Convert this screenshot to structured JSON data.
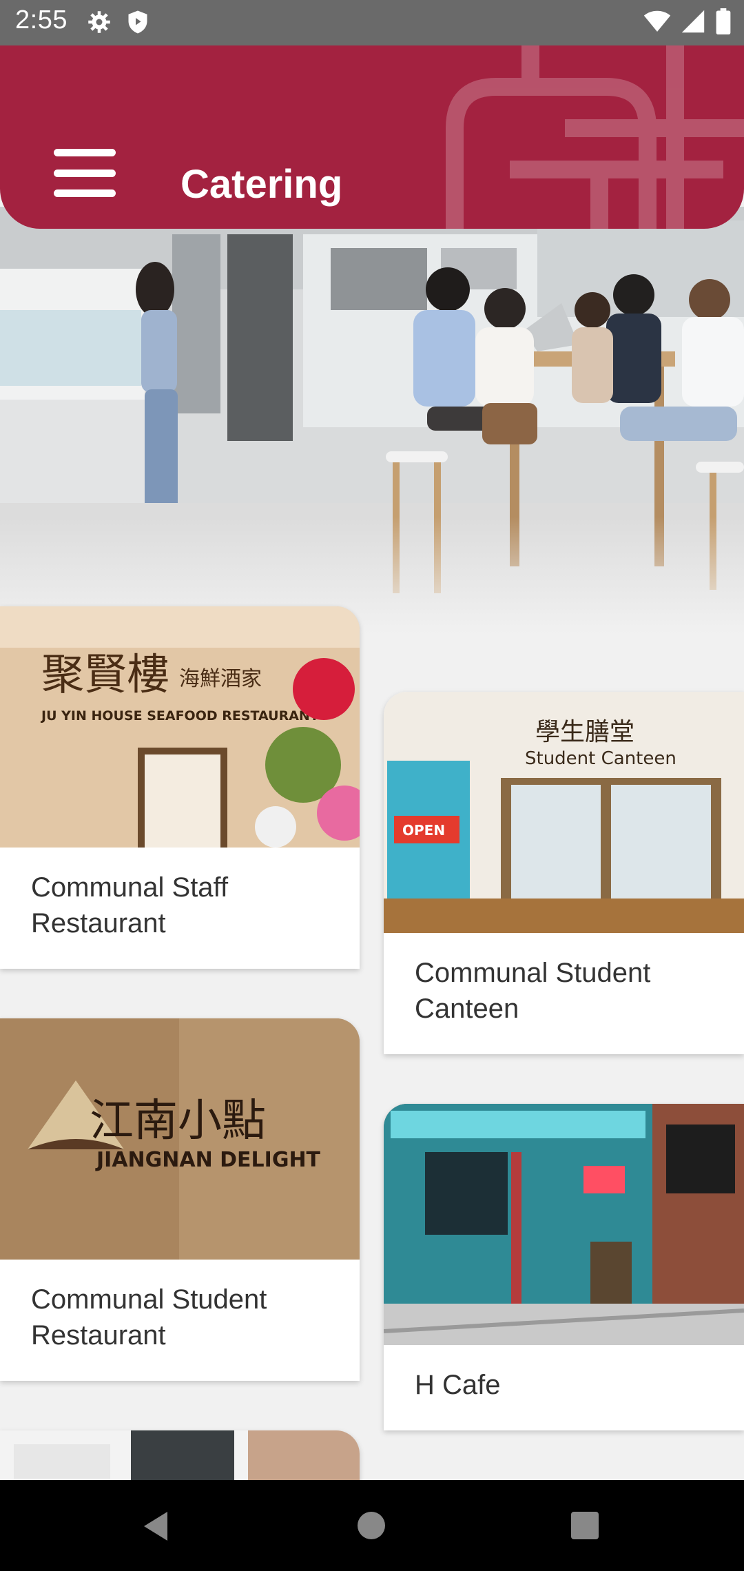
{
  "status_bar": {
    "time": "2:55",
    "icons": [
      "settings-icon",
      "shield-icon",
      "wifi-icon",
      "signal-icon",
      "battery-icon"
    ]
  },
  "app_bar": {
    "title": "Catering",
    "menu_icon": "hamburger-menu-icon",
    "color": "#a32240"
  },
  "restaurants": [
    {
      "name": "Communal Staff Restaurant",
      "image_sign": "聚賢樓 海鮮酒家 · JU YIN HOUSE SEAFOOD RESTAURANT"
    },
    {
      "name": "Communal Student Canteen",
      "image_sign": "學生膳堂 · Student Canteen"
    },
    {
      "name": "Communal Student Restaurant",
      "image_sign": "江南小點 · JIANGNAN DELIGHT"
    },
    {
      "name": "H Cafe",
      "image_sign": ""
    }
  ],
  "nav_bar": {
    "back_icon": "back-triangle-icon",
    "home_icon": "home-circle-icon",
    "recents_icon": "recents-square-icon"
  }
}
